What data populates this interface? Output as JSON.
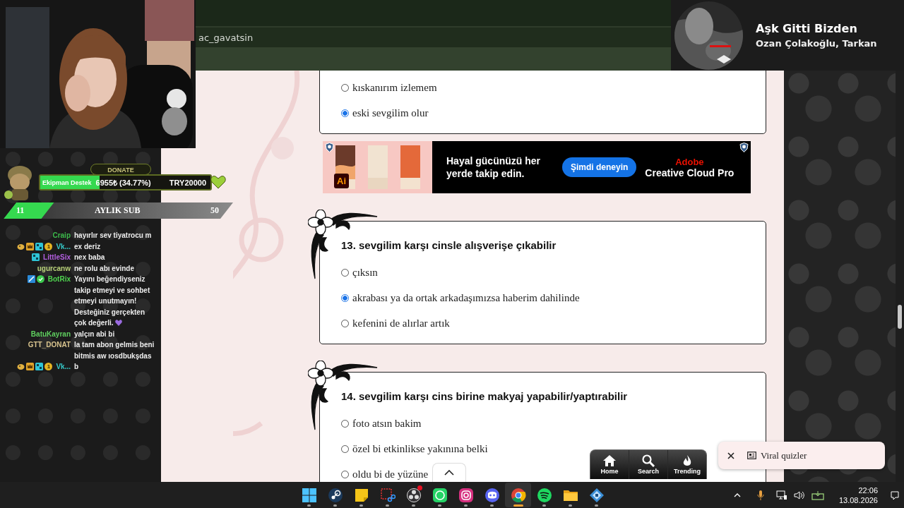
{
  "browser": {
    "header_text": "ac_gavatsin"
  },
  "donation_goal": {
    "heading": "DONATE",
    "label": "Ekipman Destek",
    "amount": "6955₺ (34.77%)",
    "target": "TRY20000",
    "level": 0.3477
  },
  "sub_goal": {
    "current": "11",
    "label": "AYLIK SUB",
    "target": "50",
    "level": 0.22
  },
  "chat": [
    {
      "user": "Craip",
      "color": "#3dbb4c",
      "text": "hayırlır sev tiyatrocu m"
    },
    {
      "user": "Vk...",
      "color": "#36c9c9",
      "badges": [
        {
          "kind": "emote"
        },
        {
          "kind": "crown"
        },
        {
          "kind": "grid"
        },
        {
          "kind": "count",
          "text": "1"
        }
      ],
      "text": "ex deriz"
    },
    {
      "user": "LittleSix",
      "color": "#b45fe0",
      "badges": [
        {
          "kind": "grid"
        }
      ],
      "text": "nex baba"
    },
    {
      "user": "ugurcanw",
      "color": "#b9d27a",
      "text": "ne rolu abı evinde"
    },
    {
      "user": "BotRix",
      "color": "#4fd34f",
      "badges": [
        {
          "kind": "sword"
        },
        {
          "kind": "verified"
        }
      ],
      "text": "Yayını beğendiyseniz takip etmeyi ve sohbet etmeyi unutmayın! Desteğiniz gerçekten çok değerli.",
      "heart": true
    },
    {
      "user": "BatuKayran",
      "color": "#5fcf5f",
      "text": "yalçın abi bi"
    },
    {
      "user": "GTT_DONAT",
      "color": "#d9c48e",
      "text": "la tam abon gelmis beni bitmis aw ıosdbukşdas"
    },
    {
      "user": "Vk...",
      "color": "#36c9c9",
      "badges": [
        {
          "kind": "emote"
        },
        {
          "kind": "crown"
        },
        {
          "kind": "grid"
        },
        {
          "kind": "count",
          "text": "1"
        }
      ],
      "text": "b"
    }
  ],
  "now_playing": {
    "title": "Aşk Gitti Bizden",
    "artist": "Ozan Çolakoğlu, Tarkan"
  },
  "quiz": {
    "items": [
      {
        "kind": "question",
        "options": [
          {
            "text": "kıskanırım izlemem",
            "selected": false
          },
          {
            "text": "eski sevgilim olur",
            "selected": true
          }
        ]
      },
      {
        "kind": "ad",
        "badge": "Ai",
        "headline": "Hayal gücünüzü her yerde takip edin.",
        "button": "Şimdi deneyin",
        "brand": "Adobe",
        "product": "Creative Cloud Pro"
      },
      {
        "kind": "question",
        "title": "13. sevgilim karşı cinsle alışverişe çıkabilir",
        "options": [
          {
            "text": "çıksın",
            "selected": false
          },
          {
            "text": "akrabası ya da ortak arkadaşımızsa haberim dahilinde",
            "selected": true
          },
          {
            "text": "kefenini de alırlar artık",
            "selected": false
          }
        ]
      },
      {
        "kind": "question",
        "title": "14. sevgilim karşı cins birine makyaj yapabilir/yaptırabilir",
        "options": [
          {
            "text": "foto atsın bakim",
            "selected": false
          },
          {
            "text": "özel bi etkinlikse yakınına belki",
            "selected": false
          },
          {
            "text": "oldu bi de yüzüne",
            "selected": false
          }
        ]
      }
    ]
  },
  "bottom_nav": [
    {
      "kind": "home",
      "label": "Home"
    },
    {
      "kind": "search",
      "label": "Search"
    },
    {
      "kind": "trending",
      "label": "Trending"
    }
  ],
  "toast": {
    "text": "Viral quizler"
  },
  "taskbar": {
    "apps": [
      {
        "kind": "start",
        "selected": false,
        "alert": false
      },
      {
        "kind": "steam",
        "selected": false,
        "alert": false
      },
      {
        "kind": "notes",
        "selected": false,
        "alert": false
      },
      {
        "kind": "snip",
        "selected": false,
        "alert": false
      },
      {
        "kind": "obs",
        "selected": false,
        "alert": true
      },
      {
        "kind": "whatsapp",
        "selected": false,
        "alert": false
      },
      {
        "kind": "instagram",
        "selected": false,
        "alert": false
      },
      {
        "kind": "discord",
        "selected": false,
        "alert": false
      },
      {
        "kind": "chrome",
        "selected": true,
        "alert": false
      },
      {
        "kind": "spotify",
        "selected": false,
        "alert": false
      },
      {
        "kind": "files",
        "selected": false,
        "alert": false
      },
      {
        "kind": "app",
        "selected": false,
        "alert": false
      }
    ],
    "clock": {
      "time": "22:06",
      "date": "13.08.2026"
    }
  }
}
